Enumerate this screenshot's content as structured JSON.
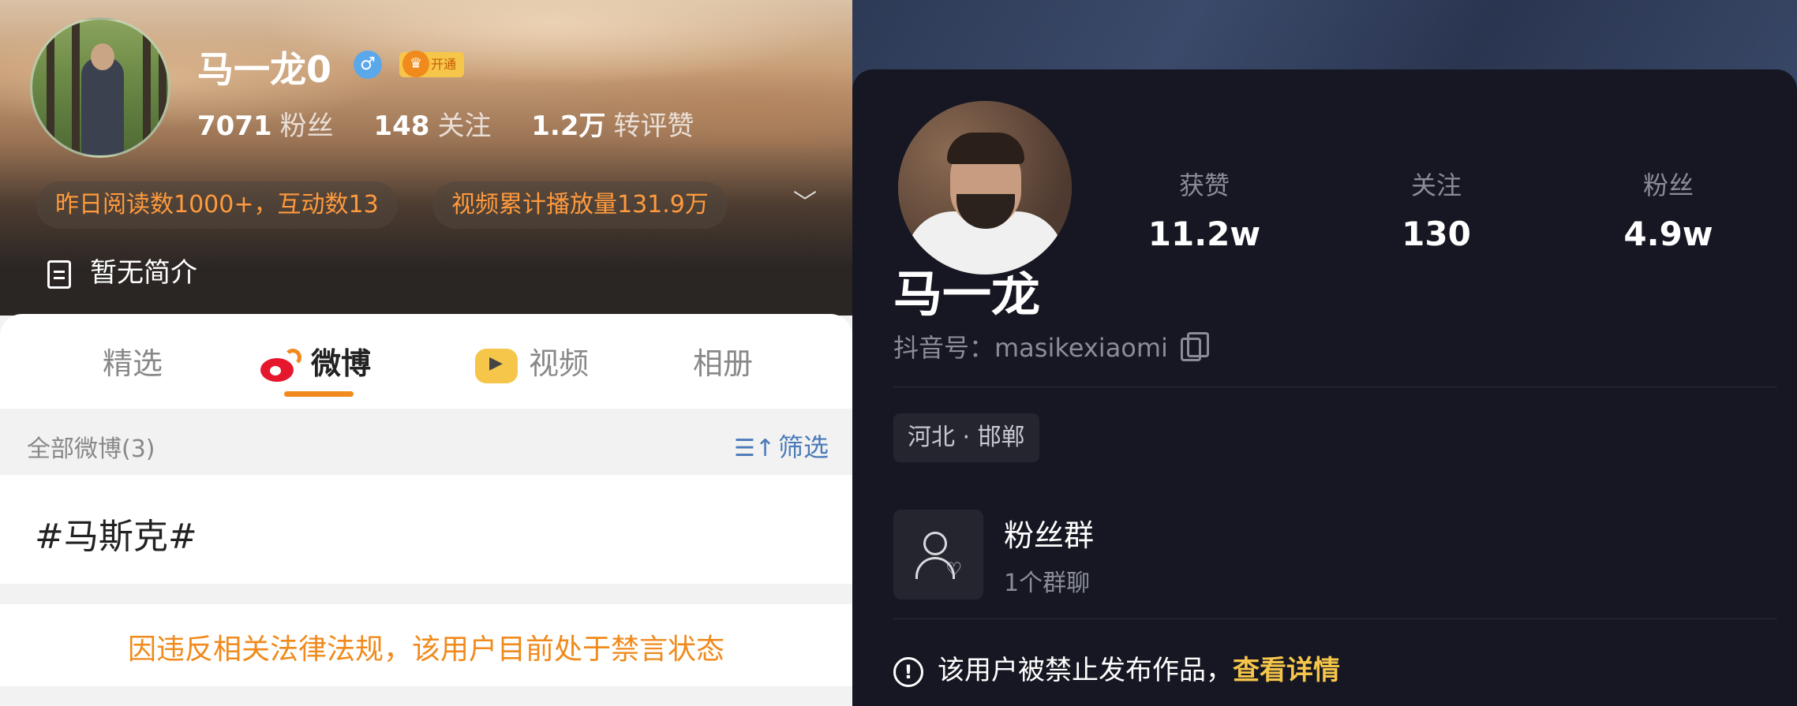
{
  "weibo": {
    "username": "马一龙0",
    "gender_symbol": "♂",
    "vip_label": "开通",
    "stats": [
      {
        "value": "7071",
        "label": "粉丝"
      },
      {
        "value": "148",
        "label": "关注"
      },
      {
        "value": "1.2万",
        "label": "转评赞"
      }
    ],
    "pills": [
      "昨日阅读数1000+，互动数13",
      "视频累计播放量131.9万"
    ],
    "expand_symbol": "﹀",
    "bio": "暂无简介",
    "tabs": [
      "精选",
      "微博",
      "视频",
      "相册"
    ],
    "active_tab": "微博",
    "feed_count_label": "全部微博(3)",
    "filter_label": "筛选",
    "post_text": "#马斯克#",
    "ban_notice": "因违反相关法律法规，该用户目前处于禁言状态",
    "accent_color": "#f08a1c"
  },
  "douyin": {
    "stats": [
      {
        "label": "获赞",
        "value": "11.2w"
      },
      {
        "label": "关注",
        "value": "130"
      },
      {
        "label": "粉丝",
        "value": "4.9w"
      }
    ],
    "username": "马一龙",
    "douyin_id_label": "抖音号：masikexiaomi",
    "location": "河北 · 邯郸",
    "fan_group_title": "粉丝群",
    "fan_group_sub": "1个群聊",
    "warning_text": "该用户被禁止发布作品，",
    "warning_link": "查看详情",
    "link_color": "#f6c64b"
  }
}
